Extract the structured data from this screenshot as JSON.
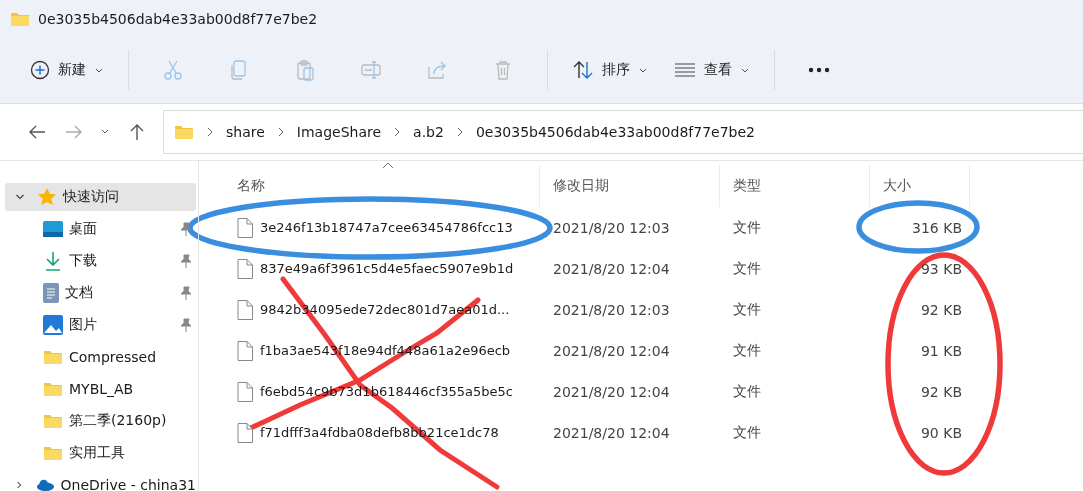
{
  "window": {
    "title": "0e3035b4506dab4e33ab00d8f77e7be2"
  },
  "toolbar": {
    "new_label": "新建",
    "actions": [
      {
        "disabled": true
      },
      {
        "disabled": true
      },
      {
        "disabled": true
      },
      {
        "disabled": true
      },
      {
        "disabled": true
      },
      {
        "disabled": true
      }
    ],
    "sort_label": "排序",
    "view_label": "查看"
  },
  "navigation": {
    "back_disabled": false,
    "forward_disabled": true
  },
  "address": {
    "segments": [
      "share",
      "ImageShare",
      "a.b2",
      "0e3035b4506dab4e33ab00d8f77e7be2"
    ]
  },
  "sidebar": {
    "items": [
      {
        "kind": "star",
        "label": "快速访问",
        "selected": true,
        "expanded": true,
        "children": [
          {
            "kind": "desktop",
            "label": "桌面",
            "selected": false,
            "pinned": true
          },
          {
            "kind": "download",
            "label": "下载",
            "selected": false,
            "pinned": true
          },
          {
            "kind": "document",
            "label": "文档",
            "selected": false,
            "pinned": true
          },
          {
            "kind": "picture",
            "label": "图片",
            "selected": false,
            "pinned": true
          },
          {
            "kind": "folder",
            "label": "Compressed",
            "selected": false,
            "pinned": false
          },
          {
            "kind": "folder",
            "label": "MYBL_AB",
            "selected": false,
            "pinned": false
          },
          {
            "kind": "folder",
            "label": "第二季(2160p)",
            "selected": false,
            "pinned": false
          },
          {
            "kind": "folder",
            "label": "实用工具",
            "selected": false,
            "pinned": false
          }
        ]
      },
      {
        "kind": "cloud",
        "label": "OneDrive - china31",
        "selected": false,
        "expanded": false
      }
    ]
  },
  "table": {
    "columns": [
      {
        "label": "名称",
        "sorted": true
      },
      {
        "label": "修改日期",
        "sorted": false
      },
      {
        "label": "类型",
        "sorted": false
      },
      {
        "label": "大小",
        "sorted": false
      }
    ],
    "rows": [
      {
        "name": "3e246f13b18747a7cee63454786fcc13",
        "date": "2021/8/20 12:03",
        "type": "文件",
        "size": "316 KB"
      },
      {
        "name": "837e49a6f3961c5d4e5faec5907e9b1d",
        "date": "2021/8/20 12:04",
        "type": "文件",
        "size": "93 KB"
      },
      {
        "name": "9842b34095ede72dec801d7aea01d...",
        "date": "2021/8/20 12:03",
        "type": "文件",
        "size": "92 KB"
      },
      {
        "name": "f1ba3ae543f18e94df448a61a2e96ecb",
        "date": "2021/8/20 12:04",
        "type": "文件",
        "size": "91 KB"
      },
      {
        "name": "f6ebd54c9b73d1b618446cf355a5be5c",
        "date": "2021/8/20 12:04",
        "type": "文件",
        "size": "92 KB"
      },
      {
        "name": "f71dfff3a4fdba08defb8bb21ce1dc78",
        "date": "2021/8/20 12:04",
        "type": "文件",
        "size": "90 KB"
      }
    ]
  },
  "annotations": [
    {
      "kind": "ellipse",
      "color": "#3a8ee0"
    },
    {
      "kind": "ellipse",
      "color": "#3a8ee0"
    },
    {
      "kind": "cross",
      "color": "#f03a3a"
    },
    {
      "kind": "ellipse",
      "color": "#f03a3a"
    }
  ]
}
